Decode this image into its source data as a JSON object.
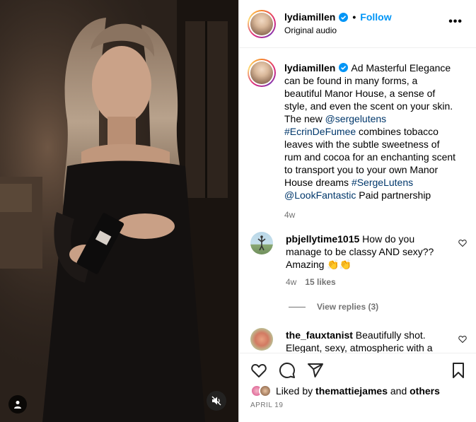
{
  "post": {
    "username": "lydiamillen",
    "follow_label": "Follow",
    "separator": "•",
    "audio": "Original audio",
    "more": "•••"
  },
  "caption": {
    "username": "lydiamillen",
    "text_a": "Ad Masterful Elegance can be found in many forms, a beautiful Manor House, a sense of style, and even the scent on your skin. The new ",
    "mention_1": "@sergelutens",
    "text_b": " ",
    "hashtag_1": "#EcrinDeFumee",
    "text_c": " combines tobacco leaves with the subtle sweetness of rum and cocoa for an enchanting scent to transport you to your own Manor House dreams ",
    "hashtag_2": "#SergeLutens",
    "text_d": " ",
    "mention_2": "@LookFantastic",
    "text_e": " Paid partnership",
    "time": "4w"
  },
  "comments": [
    {
      "username": "pbjellytime1015",
      "text": " How do you manage to be classy AND sexy?? Amazing 👏👏",
      "time": "4w",
      "likes": "15 likes",
      "view_replies": "View replies (3)"
    },
    {
      "username": "the_fauxtanist",
      "text": " Beautifully shot. Elegant, sexy, atmospheric with a"
    }
  ],
  "footer": {
    "liked_prefix": "Liked by ",
    "liked_user": "themattiejames",
    "liked_and": " and ",
    "liked_others": "others",
    "date": "APRIL 19"
  },
  "icons": {
    "verified_color": "#0095f6",
    "follow_color": "#0095f6",
    "link_color": "#00376b"
  }
}
